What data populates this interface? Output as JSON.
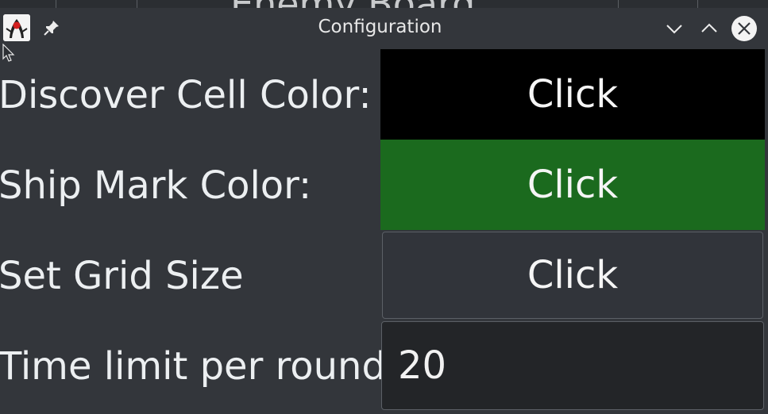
{
  "background_app": {
    "title_fragment": "Enemy Board"
  },
  "window": {
    "title": "Configuration",
    "icons": {
      "app": "java-duke-icon",
      "pin": "pin-icon",
      "minimize": "chevron-down-icon",
      "maximize": "chevron-up-icon",
      "close": "close-icon",
      "cursor": "mouse-pointer-icon"
    }
  },
  "rows": [
    {
      "label": "Discover Cell Color:",
      "button_label": "Click",
      "button_color": "#000000"
    },
    {
      "label": "Ship Mark Color:",
      "button_label": "Click",
      "button_color": "#1b6a1e"
    },
    {
      "label": "Set Grid Size",
      "button_label": "Click"
    },
    {
      "label": "Time limit per round",
      "field_value": "20"
    }
  ],
  "colors": {
    "dialog_bg": "#33363b",
    "field_bg": "#232528",
    "text": "#eceff1"
  }
}
